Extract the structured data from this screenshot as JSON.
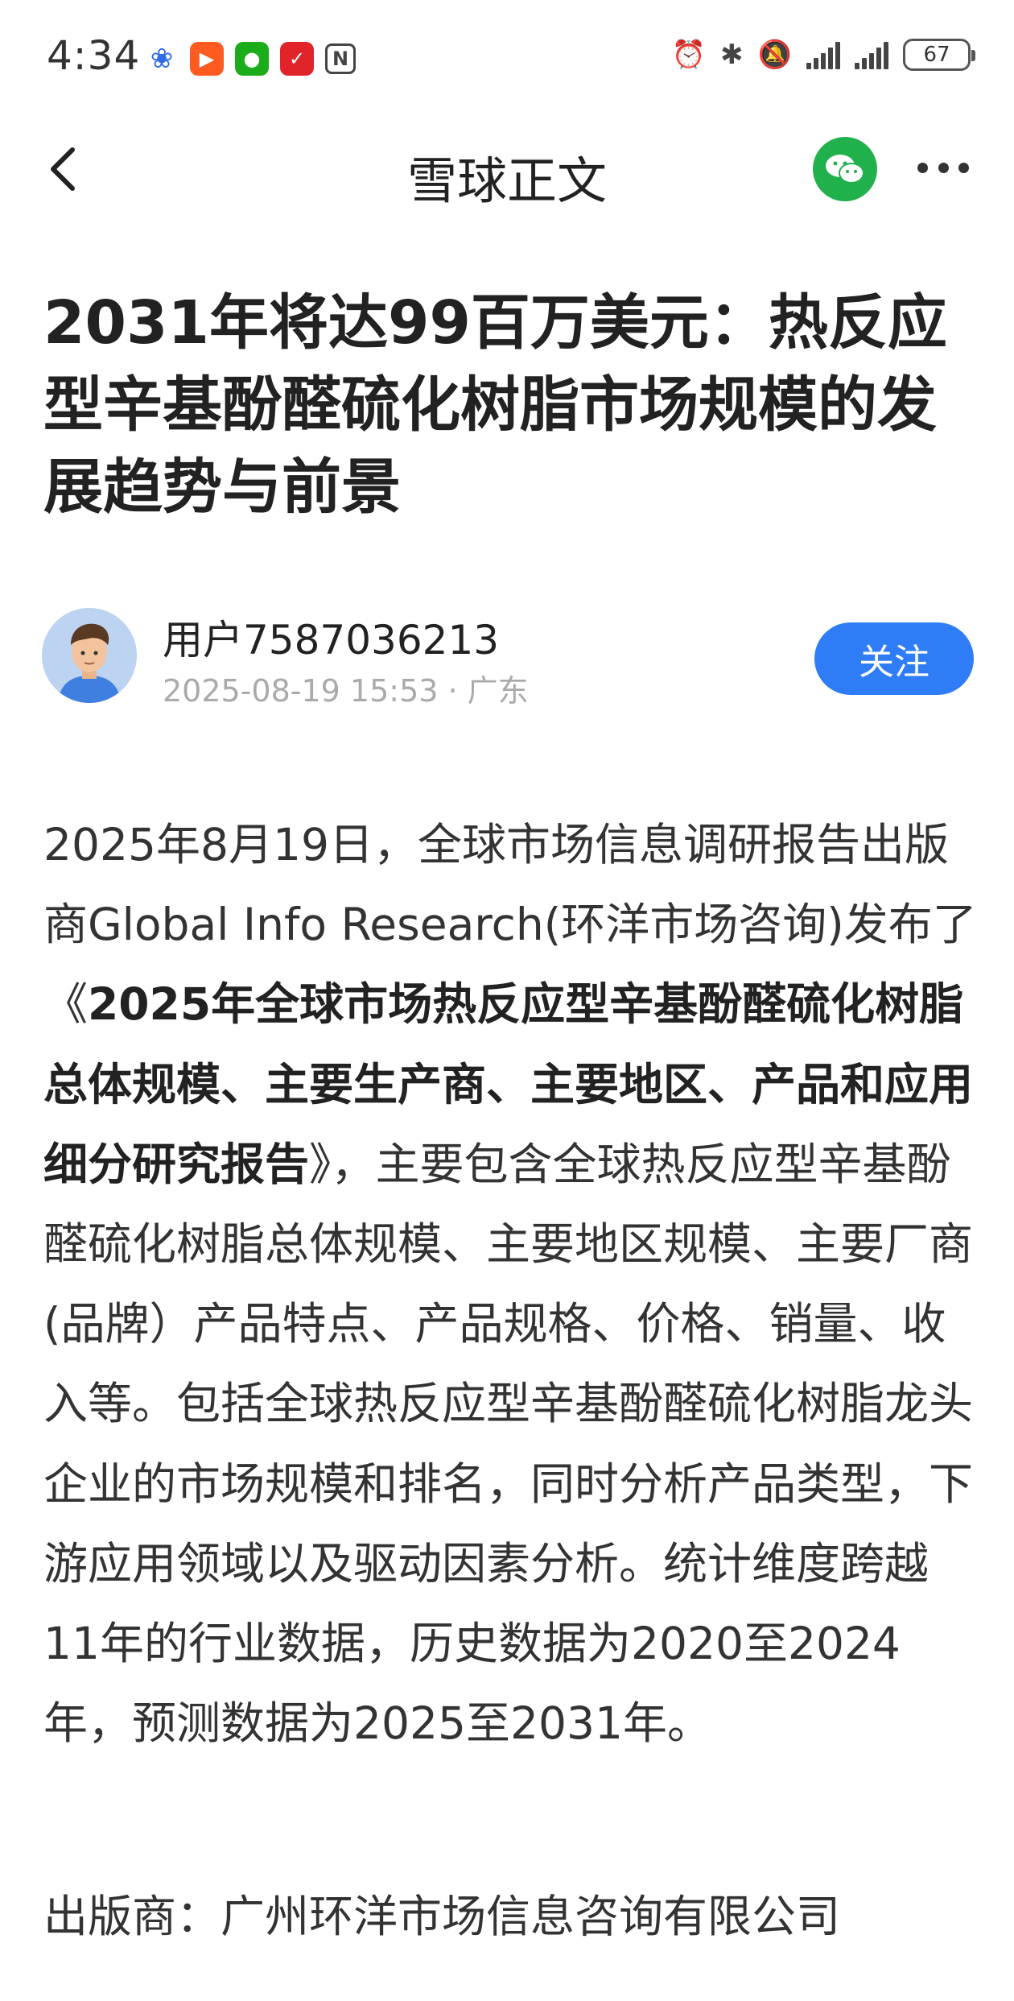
{
  "status_bar": {
    "time": "4:34",
    "battery": "67",
    "apps": [
      "baidu-app-icon",
      "kuaishou-app-icon",
      "wechat-app-icon",
      "red-app-icon",
      "nfc-icon"
    ]
  },
  "nav": {
    "title": "雪球正文"
  },
  "article": {
    "title": "2031年将达99百万美元：热反应型辛基酚醛硫化树脂市场规模的发展趋势与前景",
    "author_name": "用户7587036213",
    "meta": "2025-08-19 15:53 · 广东",
    "follow_label": "关注",
    "body_intro": "2025年8月19日，全球市场信息调研报告出版商Global Info Research(环洋市场咨询)发布了《",
    "body_bold": "2025年全球市场热反应型辛基酚醛硫化树脂总体规模、主要生产商、主要地区、产品和应用细分研究报告",
    "body_rest": "》，主要包含全球热反应型辛基酚醛硫化树脂总体规模、主要地区规模、主要厂商(品牌）产品特点、产品规格、价格、销量、收入等。包括全球热反应型辛基酚醛硫化树脂龙头企业的市场规模和排名，同时分析产品类型，下游应用领域以及驱动因素分析。统计维度跨越11年的行业数据，历史数据为2020至2024年，预测数据为2025至2031年。",
    "publisher": "出版商：广州环洋市场信息咨询有限公司"
  }
}
